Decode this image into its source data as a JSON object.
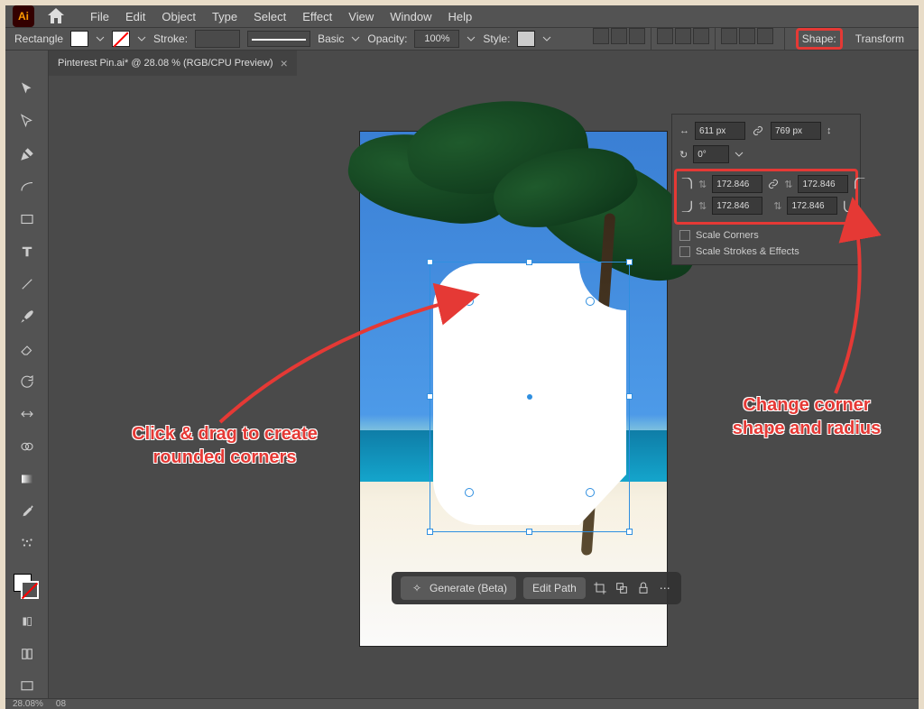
{
  "menubar": [
    "File",
    "Edit",
    "Object",
    "Type",
    "Select",
    "Effect",
    "View",
    "Window",
    "Help"
  ],
  "controlbar": {
    "shape_label": "Rectangle",
    "stroke_label": "Stroke:",
    "stroke_pt": "",
    "stroke_style": "Basic",
    "opacity_label": "Opacity:",
    "opacity_value": "100%",
    "style_label": "Style:",
    "shape_tab": "Shape:",
    "transform_tab": "Transform"
  },
  "tab": {
    "title": "Pinterest Pin.ai* @ 28.08 % (RGB/CPU Preview)",
    "close": "×"
  },
  "shape_panel": {
    "width": "611 px",
    "height": "769 px",
    "rotation": "0°",
    "corners": {
      "tl": "172.846",
      "tr": "172.846",
      "bl": "172.846",
      "br": "172.846"
    },
    "scale_corners": "Scale Corners",
    "scale_strokes": "Scale Strokes & Effects"
  },
  "context_bar": {
    "generate": "Generate (Beta)",
    "edit_path": "Edit Path"
  },
  "annotations": {
    "left": "Click & drag to create rounded corners",
    "right": "Change corner shape and radius"
  },
  "status": {
    "zoom": "28.08%",
    "extra": "08"
  }
}
